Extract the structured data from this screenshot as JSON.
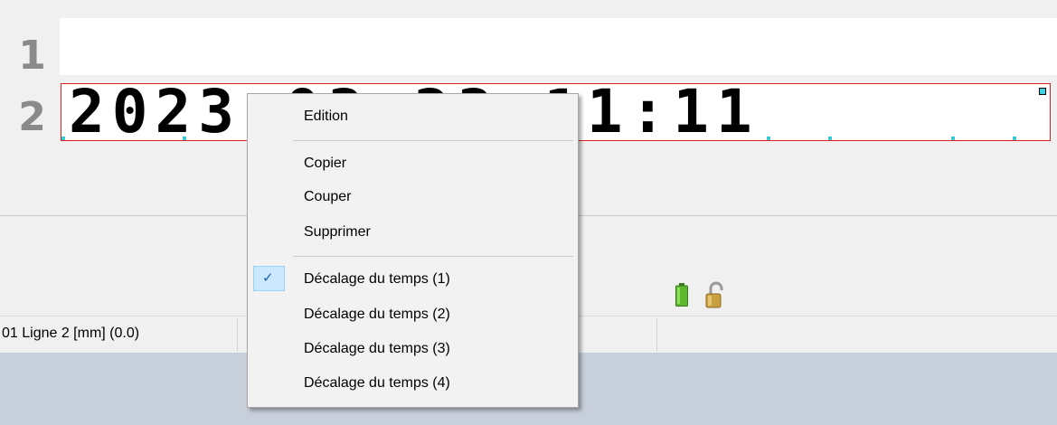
{
  "editor": {
    "line1_number": "1",
    "line2_number": "2",
    "line1_text": "",
    "line2_text": "2023-03-23 11:11"
  },
  "status_bar": {
    "position_text": "01 Ligne 2 [mm] (0.0)"
  },
  "icons": {
    "battery": "battery-icon",
    "lock": "unlocked-padlock-icon"
  },
  "context_menu": {
    "edition": "Edition",
    "copy": "Copier",
    "cut": "Couper",
    "delete": "Supprimer",
    "offset_1": "Décalage du temps (1)",
    "offset_2": "Décalage du temps (2)",
    "offset_3": "Décalage du temps (3)",
    "offset_4": "Décalage du temps (4)",
    "checked_item": "Décalage du temps (1)",
    "check_glyph": "✓"
  },
  "colors": {
    "selection_border": "#e02020",
    "menu_highlight": "#cce8ff",
    "battery_green": "#5cb82e",
    "lock_gold": "#c8a040"
  }
}
